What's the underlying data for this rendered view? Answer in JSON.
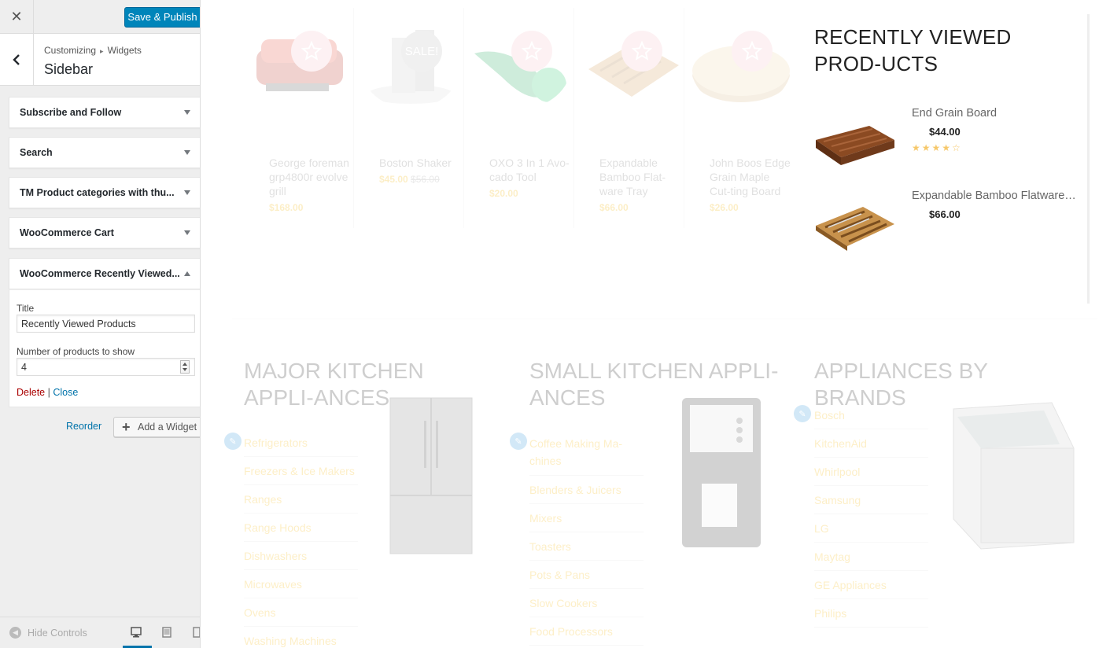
{
  "header": {
    "close_glyph": "✕",
    "publish_label": "Save & Publish"
  },
  "section": {
    "breadcrumb_parent": "Customizing",
    "breadcrumb_child": "Widgets",
    "title": "Sidebar"
  },
  "widgets": [
    {
      "label": "Subscribe and Follow",
      "expanded": false
    },
    {
      "label": "Search",
      "expanded": false
    },
    {
      "label": "TM Product categories with thu...",
      "expanded": false
    },
    {
      "label": "WooCommerce Cart",
      "expanded": false
    },
    {
      "label": "WooCommerce Recently Viewed...",
      "expanded": true
    }
  ],
  "widget_form": {
    "title_label": "Title",
    "title_value": "Recently Viewed Products",
    "count_label": "Number of products to show",
    "count_value": "4",
    "delete_label": "Delete",
    "separator": "|",
    "close_label": "Close"
  },
  "actions": {
    "reorder_label": "Reorder",
    "add_widget_label": "Add a Widget"
  },
  "footer": {
    "hide_controls_label": "Hide Controls"
  },
  "products": [
    {
      "name": "George foreman grp4800r evolve grill",
      "price": "$168.00",
      "old_price": "",
      "badge": "star"
    },
    {
      "name": "Boston Shaker",
      "price": "$45.00",
      "old_price": "$56.00",
      "badge": "SALE!"
    },
    {
      "name": "OXO 3 In 1 Avo-cado Tool",
      "price": "$20.00",
      "old_price": "",
      "badge": "star"
    },
    {
      "name": "Expandable Bamboo Flat-ware Tray",
      "price": "$66.00",
      "old_price": "",
      "badge": "star"
    },
    {
      "name": "John Boos Edge Grain Maple Cut-ting Board",
      "price": "$26.00",
      "old_price": "",
      "badge": "star"
    }
  ],
  "recently_viewed": {
    "title": "RECENTLY VIEWED PROD-UCTS",
    "items": [
      {
        "name": "End Grain Board",
        "price": "$44.00",
        "rating": 4,
        "stars": "★★★★☆"
      },
      {
        "name": "Expandable Bamboo Flatware ...",
        "price": "$66.00",
        "stars": ""
      }
    ]
  },
  "categories": [
    {
      "title": "MAJOR KITCHEN APPLI-ANCES",
      "items": [
        "Refrigerators",
        "Freezers & Ice Makers",
        "Ranges",
        "Range Hoods",
        "Dishwashers",
        "Microwaves",
        "Ovens",
        "Washing Machines"
      ]
    },
    {
      "title": "SMALL KITCHEN APPLI-ANCES",
      "items": [
        "Coffee Making Ma-chines",
        "Blenders & Juicers",
        "Mixers",
        "Toasters",
        "Pots & Pans",
        "Slow Cookers",
        "Food Processors"
      ]
    },
    {
      "title": "APPLIANCES BY BRANDS",
      "items": [
        "Bosch",
        "KitchenAid",
        "Whirlpool",
        "Samsung",
        "LG",
        "Maytag",
        "GE Appliances",
        "Philips"
      ]
    }
  ],
  "colors": {
    "accent": "#0085ba",
    "link": "#0073aa",
    "delete": "#a00",
    "price": "#f4b400",
    "badge": "#f7c2cb"
  }
}
